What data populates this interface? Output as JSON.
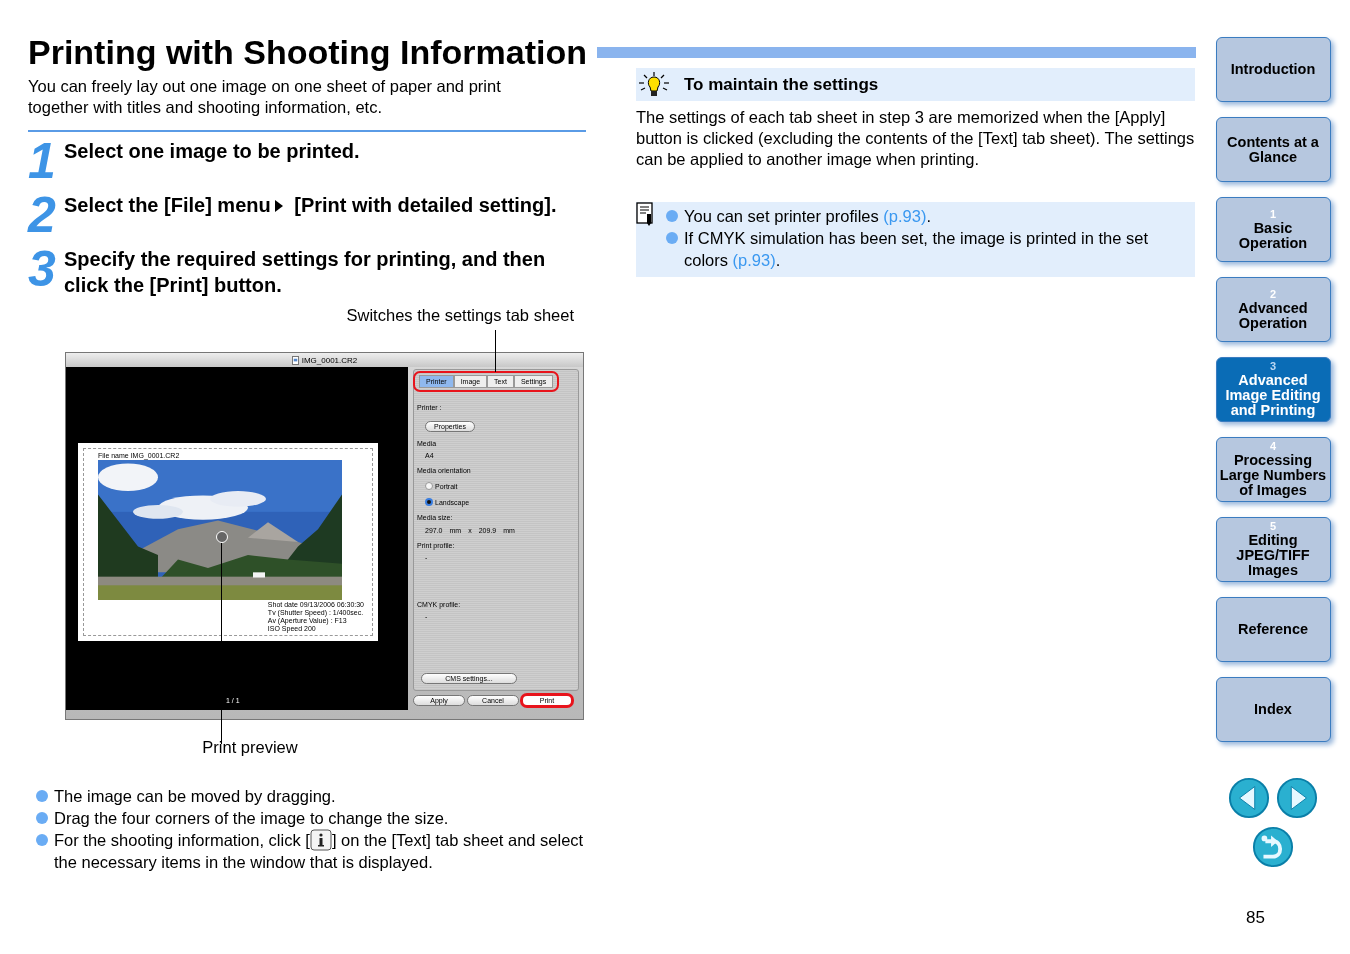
{
  "title": "Printing with Shooting Information",
  "intro": "You can freely lay out one image on one sheet of paper and print together with titles and shooting information, etc.",
  "steps": [
    {
      "number": "1",
      "parts": [
        "Select one image to be printed."
      ]
    },
    {
      "number": "2",
      "parts": [
        "Select the [File] menu",
        "[Print with detailed setting]."
      ]
    },
    {
      "number": "3",
      "parts": [
        "Specify the required settings for printing, and then click the [Print] button."
      ]
    }
  ],
  "callout_top": "Switches the settings tab sheet",
  "callout_bottom": "Print preview",
  "app_window": {
    "title": "IMG_0001.CR2",
    "preview": {
      "file_name": "File name IMG_0001.CR2",
      "shot_info": [
        "Shot date 09/13/2006 06:30:30",
        "Tv (Shutter Speed) : 1/400sec.",
        "Av (Aperture Value) : F13",
        "ISO Speed 200"
      ],
      "page_counter": "1 / 1"
    },
    "tabs_highlighted": true,
    "tabs": [
      {
        "label": "Printer",
        "selected": true
      },
      {
        "label": "Image",
        "selected": false
      },
      {
        "label": "Text",
        "selected": false
      },
      {
        "label": "Settings",
        "selected": false
      }
    ],
    "printer_label": "Printer :",
    "properties_button": "Properties",
    "media_label": "Media",
    "media_value": "A4",
    "orientation_label": "Media orientation",
    "orientations": [
      {
        "label": "Portrait",
        "selected": false
      },
      {
        "label": "Landscape",
        "selected": true
      }
    ],
    "media_size_label": "Media size:",
    "media_size": [
      "297.0",
      "mm",
      "x",
      "209.9",
      "mm"
    ],
    "print_profile_label": "Print profile:",
    "print_profile_value": "-",
    "cmyk_label": "CMYK profile:",
    "cmyk_value": "-",
    "cms_button": "CMS settings...",
    "buttons": [
      {
        "label": "Apply",
        "highlighted": false
      },
      {
        "label": "Cancel",
        "highlighted": false
      },
      {
        "label": "Print",
        "highlighted": true
      }
    ]
  },
  "bullets": [
    {
      "before": "The image can be moved by dragging."
    },
    {
      "before": "Drag the four corners of the image to change the size."
    },
    {
      "before": "For the shooting information, click [",
      "after": "] on the [Text] tab sheet and select the necessary items in the window that is displayed."
    }
  ],
  "tip": {
    "title": "To maintain the settings",
    "body": "The settings of each tab sheet in step 3 are memorized when the [Apply] button is clicked (excluding the contents of the [Text] tab sheet). The settings can be applied to another image when printing."
  },
  "memo": [
    {
      "text": "You can set printer profiles ",
      "link": "(p.93)",
      "after": "."
    },
    {
      "text": "If CMYK simulation has been set, the image is printed in the set colors ",
      "link": "(p.93)",
      "after": "."
    }
  ],
  "nav": [
    {
      "label": "Introduction",
      "selected": false
    },
    {
      "label": "Contents at a Glance",
      "selected": false
    },
    {
      "label": "Basic Operation",
      "number": "1",
      "selected": false
    },
    {
      "label": "Advanced Operation",
      "number": "2",
      "selected": false
    },
    {
      "label": "Advanced Image Editing and Printing",
      "number": "3",
      "selected": true
    },
    {
      "label": "Processing Large Numbers of Images",
      "number": "4",
      "selected": false
    },
    {
      "label": "Editing JPEG/TIFF Images",
      "number": "5",
      "selected": false
    },
    {
      "label": "Reference",
      "selected": false
    },
    {
      "label": "Index",
      "selected": false
    }
  ],
  "page_number": "85"
}
